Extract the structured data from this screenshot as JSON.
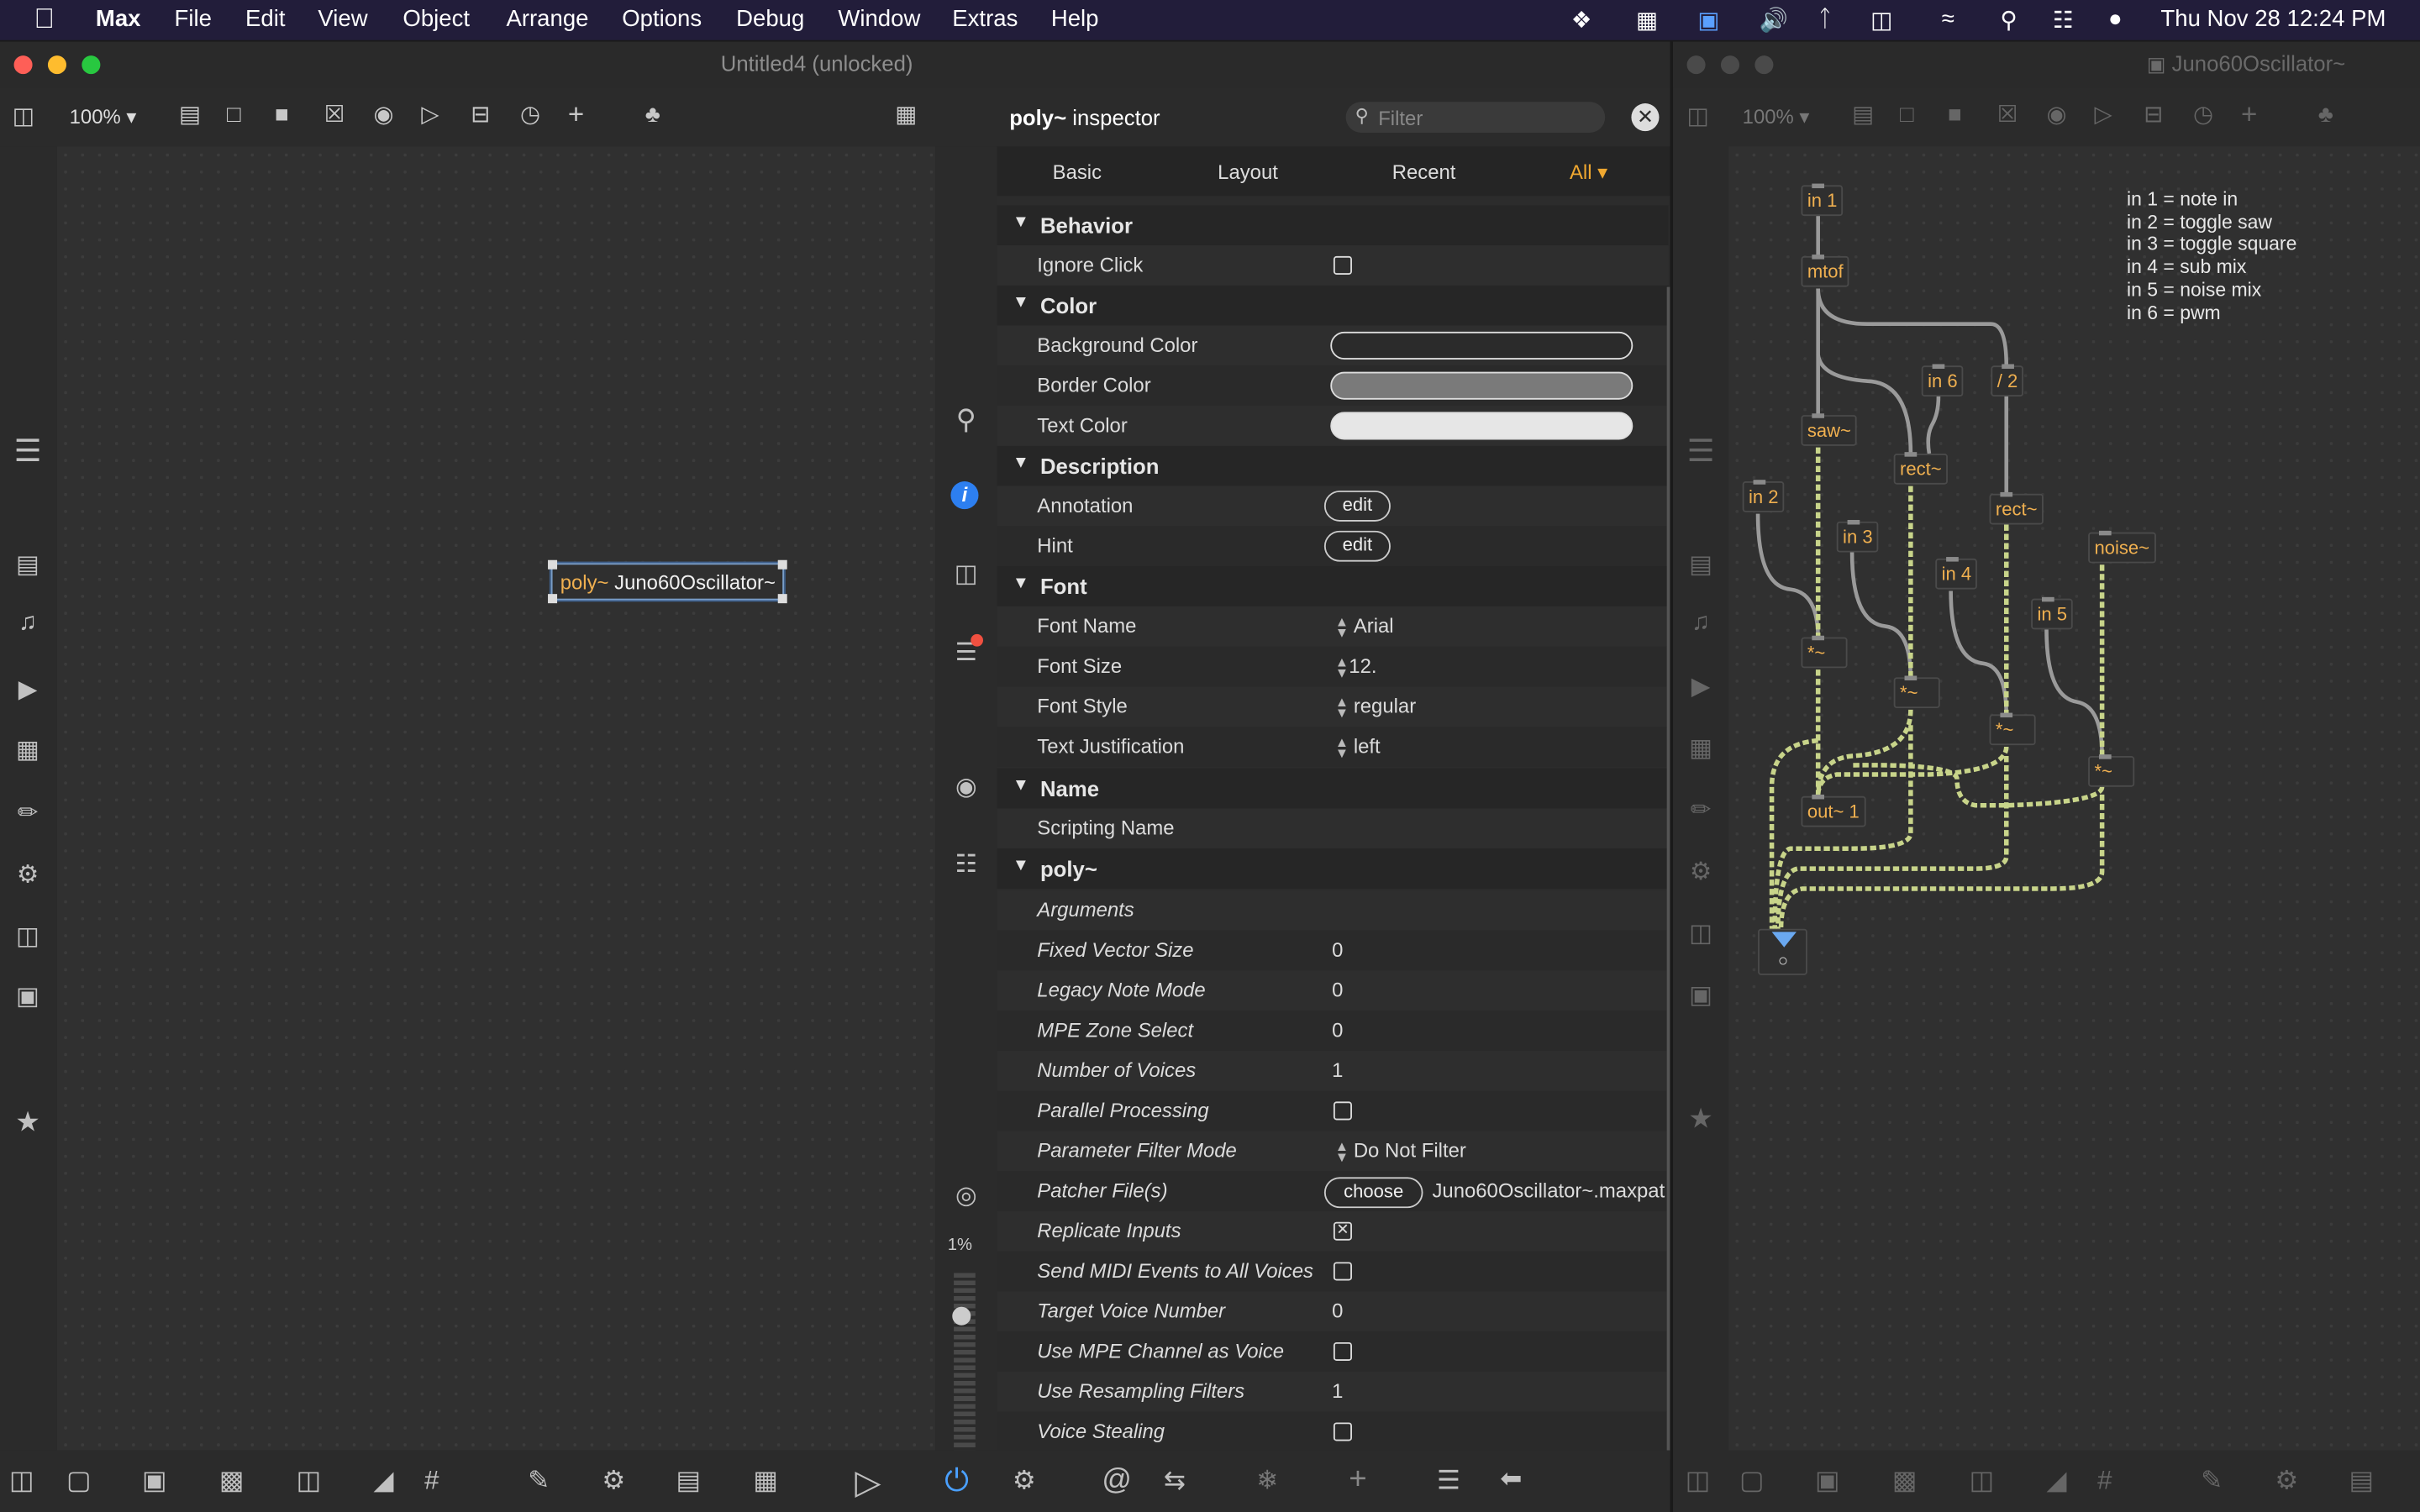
{
  "menubar": {
    "app": "Max",
    "items": [
      "File",
      "Edit",
      "View",
      "Object",
      "Arrange",
      "Options",
      "Debug",
      "Window",
      "Extras",
      "Help"
    ],
    "clock": "Thu Nov 28  12:24 PM"
  },
  "left_window": {
    "title": "Untitled4 (unlocked)",
    "zoom": "100%",
    "object_text_prefix": "poly~",
    "object_text_arg": "Juno60Oscillator~",
    "cpu": "1%"
  },
  "inspector": {
    "title_obj": "poly~",
    "title_rest": "inspector",
    "filter_placeholder": "Filter",
    "tabs": [
      "Basic",
      "Layout",
      "Recent",
      "All"
    ],
    "sections": {
      "behavior": "Behavior",
      "color": "Color",
      "description": "Description",
      "font": "Font",
      "name": "Name",
      "poly": "poly~"
    },
    "rows": {
      "ignore_click": "Ignore Click",
      "background_color": "Background Color",
      "border_color": "Border Color",
      "text_color": "Text Color",
      "annotation": "Annotation",
      "hint": "Hint",
      "edit_label": "edit",
      "font_name": "Font Name",
      "font_name_val": "Arial",
      "font_size": "Font Size",
      "font_size_val": "12.",
      "font_style": "Font Style",
      "font_style_val": "regular",
      "text_justification": "Text Justification",
      "text_justification_val": "left",
      "scripting_name": "Scripting Name",
      "arguments": "Arguments",
      "fixed_vector_size": "Fixed Vector Size",
      "fixed_vector_size_val": "0",
      "legacy_note_mode": "Legacy Note Mode",
      "legacy_note_mode_val": "0",
      "mpe_zone_select": "MPE Zone Select",
      "mpe_zone_select_val": "0",
      "number_of_voices": "Number of Voices",
      "number_of_voices_val": "1",
      "parallel_processing": "Parallel Processing",
      "parameter_filter_mode": "Parameter Filter Mode",
      "parameter_filter_mode_val": "Do Not Filter",
      "patcher_files": "Patcher File(s)",
      "choose_label": "choose",
      "patcher_file_val": "Juno60Oscillator~.maxpat",
      "replicate_inputs": "Replicate Inputs",
      "send_midi": "Send MIDI Events to All Voices",
      "target_voice_number": "Target Voice Number",
      "target_voice_number_val": "0",
      "use_mpe_channel": "Use MPE Channel as Voice",
      "use_resampling": "Use Resampling Filters",
      "use_resampling_val": "1",
      "voice_stealing": "Voice Stealing"
    },
    "colors": {
      "background": "#ffffff",
      "border": "#7a7a7a",
      "text": "#e6e6e6",
      "accent": "#f0a830"
    }
  },
  "right_window": {
    "title": "Juno60Oscillator~",
    "zoom": "100%",
    "objects": {
      "in1": "in 1",
      "mtof": "mtof",
      "in6": "in 6",
      "div2": "/ 2",
      "saw": "saw~",
      "rect1": "rect~",
      "in2": "in 2",
      "rect2": "rect~",
      "in3": "in 3",
      "noise": "noise~",
      "in4": "in 4",
      "in5": "in 5",
      "mul1": "*~",
      "mul2": "*~",
      "mul3": "*~",
      "mul4": "*~",
      "out": "out~ 1"
    },
    "comment_lines": [
      "in 1 = note in",
      "in 2 = toggle saw",
      "in 3 = toggle square",
      "in 4 = sub mix",
      "in 5 = noise mix",
      "in 6 = pwm"
    ]
  }
}
